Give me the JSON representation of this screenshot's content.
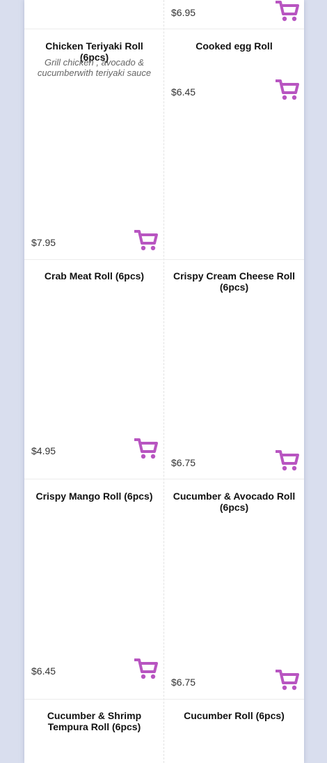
{
  "accent_color": "#b855c1",
  "cart_icon": "shopping-cart-icon",
  "items": [
    {
      "name": "",
      "description": "",
      "price": "$6.95"
    },
    {
      "name": "Chicken Teriyaki Roll (6pcs)",
      "description": "Grill chicken , avocado & cucumberwith teriyaki sauce",
      "price": "$7.95"
    },
    {
      "name": "Cooked egg Roll",
      "description": "",
      "price": "$6.45"
    },
    {
      "name": "Crab Meat Roll (6pcs)",
      "description": "",
      "price": "$4.95"
    },
    {
      "name": "Crispy Cream Cheese Roll (6pcs)",
      "description": "",
      "price": "$6.75"
    },
    {
      "name": "Crispy Mango Roll (6pcs)",
      "description": "",
      "price": "$6.45"
    },
    {
      "name": "Cucumber & Avocado Roll (6pcs)",
      "description": "",
      "price": "$6.75"
    },
    {
      "name": "Cucumber & Shrimp Tempura Roll (6pcs)",
      "description": "",
      "price": ""
    },
    {
      "name": "Cucumber Roll (6pcs)",
      "description": "",
      "price": ""
    }
  ]
}
